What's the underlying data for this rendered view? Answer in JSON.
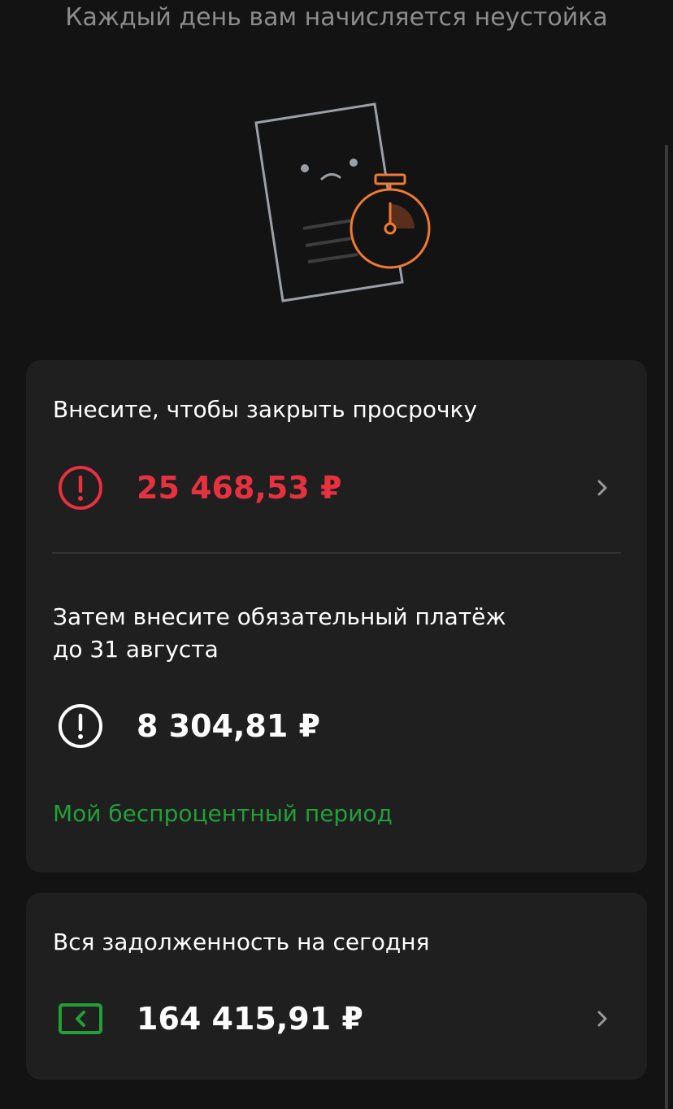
{
  "header": {
    "subtitle": "Каждый день вам начисляется неустойка"
  },
  "overdue_card": {
    "title": "Внесите, чтобы закрыть просрочку",
    "amount": "25 468,53 ₽",
    "status_icon": "alert-circle-icon",
    "status_color": "#e8313f",
    "next_payment_title_line1": "Затем внесите обязательный платёж",
    "next_payment_title_line2": "до 31 августа",
    "next_payment_amount": "8 304,81 ₽",
    "next_payment_icon": "alert-circle-icon",
    "grace_period_link": "Мой беспроцентный период",
    "link_color": "#21a038"
  },
  "debt_card": {
    "title": "Вся задолженность на сегодня",
    "amount": "164 415,91 ₽",
    "icon": "card-back-icon",
    "icon_color": "#21a038"
  },
  "colors": {
    "background": "#131313",
    "card": "#1f1f1f",
    "accent_orange": "#f07a30"
  }
}
